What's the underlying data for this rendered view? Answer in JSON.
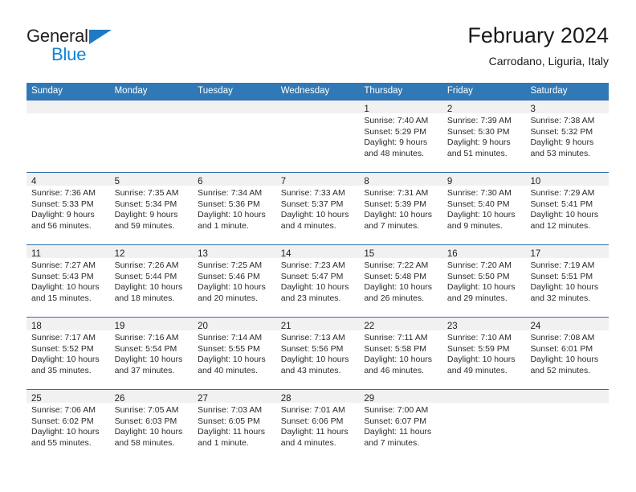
{
  "brand": {
    "name_part1": "General",
    "name_part2": "Blue",
    "triangle_icon": "logo-triangle-icon",
    "accent_color": "#0f84d8"
  },
  "header": {
    "month_title": "February 2024",
    "location": "Carrodano, Liguria, Italy"
  },
  "calendar": {
    "header_color": "#3079b6",
    "row_divider_color": "#2f6fa8",
    "day_band_color": "#f1f1f1",
    "weekdays": [
      "Sunday",
      "Monday",
      "Tuesday",
      "Wednesday",
      "Thursday",
      "Friday",
      "Saturday"
    ],
    "weeks": [
      [
        {
          "day": "",
          "sunrise": "",
          "sunset": "",
          "daylight_line1": "",
          "daylight_line2": ""
        },
        {
          "day": "",
          "sunrise": "",
          "sunset": "",
          "daylight_line1": "",
          "daylight_line2": ""
        },
        {
          "day": "",
          "sunrise": "",
          "sunset": "",
          "daylight_line1": "",
          "daylight_line2": ""
        },
        {
          "day": "",
          "sunrise": "",
          "sunset": "",
          "daylight_line1": "",
          "daylight_line2": ""
        },
        {
          "day": "1",
          "sunrise": "Sunrise: 7:40 AM",
          "sunset": "Sunset: 5:29 PM",
          "daylight_line1": "Daylight: 9 hours",
          "daylight_line2": "and 48 minutes."
        },
        {
          "day": "2",
          "sunrise": "Sunrise: 7:39 AM",
          "sunset": "Sunset: 5:30 PM",
          "daylight_line1": "Daylight: 9 hours",
          "daylight_line2": "and 51 minutes."
        },
        {
          "day": "3",
          "sunrise": "Sunrise: 7:38 AM",
          "sunset": "Sunset: 5:32 PM",
          "daylight_line1": "Daylight: 9 hours",
          "daylight_line2": "and 53 minutes."
        }
      ],
      [
        {
          "day": "4",
          "sunrise": "Sunrise: 7:36 AM",
          "sunset": "Sunset: 5:33 PM",
          "daylight_line1": "Daylight: 9 hours",
          "daylight_line2": "and 56 minutes."
        },
        {
          "day": "5",
          "sunrise": "Sunrise: 7:35 AM",
          "sunset": "Sunset: 5:34 PM",
          "daylight_line1": "Daylight: 9 hours",
          "daylight_line2": "and 59 minutes."
        },
        {
          "day": "6",
          "sunrise": "Sunrise: 7:34 AM",
          "sunset": "Sunset: 5:36 PM",
          "daylight_line1": "Daylight: 10 hours",
          "daylight_line2": "and 1 minute."
        },
        {
          "day": "7",
          "sunrise": "Sunrise: 7:33 AM",
          "sunset": "Sunset: 5:37 PM",
          "daylight_line1": "Daylight: 10 hours",
          "daylight_line2": "and 4 minutes."
        },
        {
          "day": "8",
          "sunrise": "Sunrise: 7:31 AM",
          "sunset": "Sunset: 5:39 PM",
          "daylight_line1": "Daylight: 10 hours",
          "daylight_line2": "and 7 minutes."
        },
        {
          "day": "9",
          "sunrise": "Sunrise: 7:30 AM",
          "sunset": "Sunset: 5:40 PM",
          "daylight_line1": "Daylight: 10 hours",
          "daylight_line2": "and 9 minutes."
        },
        {
          "day": "10",
          "sunrise": "Sunrise: 7:29 AM",
          "sunset": "Sunset: 5:41 PM",
          "daylight_line1": "Daylight: 10 hours",
          "daylight_line2": "and 12 minutes."
        }
      ],
      [
        {
          "day": "11",
          "sunrise": "Sunrise: 7:27 AM",
          "sunset": "Sunset: 5:43 PM",
          "daylight_line1": "Daylight: 10 hours",
          "daylight_line2": "and 15 minutes."
        },
        {
          "day": "12",
          "sunrise": "Sunrise: 7:26 AM",
          "sunset": "Sunset: 5:44 PM",
          "daylight_line1": "Daylight: 10 hours",
          "daylight_line2": "and 18 minutes."
        },
        {
          "day": "13",
          "sunrise": "Sunrise: 7:25 AM",
          "sunset": "Sunset: 5:46 PM",
          "daylight_line1": "Daylight: 10 hours",
          "daylight_line2": "and 20 minutes."
        },
        {
          "day": "14",
          "sunrise": "Sunrise: 7:23 AM",
          "sunset": "Sunset: 5:47 PM",
          "daylight_line1": "Daylight: 10 hours",
          "daylight_line2": "and 23 minutes."
        },
        {
          "day": "15",
          "sunrise": "Sunrise: 7:22 AM",
          "sunset": "Sunset: 5:48 PM",
          "daylight_line1": "Daylight: 10 hours",
          "daylight_line2": "and 26 minutes."
        },
        {
          "day": "16",
          "sunrise": "Sunrise: 7:20 AM",
          "sunset": "Sunset: 5:50 PM",
          "daylight_line1": "Daylight: 10 hours",
          "daylight_line2": "and 29 minutes."
        },
        {
          "day": "17",
          "sunrise": "Sunrise: 7:19 AM",
          "sunset": "Sunset: 5:51 PM",
          "daylight_line1": "Daylight: 10 hours",
          "daylight_line2": "and 32 minutes."
        }
      ],
      [
        {
          "day": "18",
          "sunrise": "Sunrise: 7:17 AM",
          "sunset": "Sunset: 5:52 PM",
          "daylight_line1": "Daylight: 10 hours",
          "daylight_line2": "and 35 minutes."
        },
        {
          "day": "19",
          "sunrise": "Sunrise: 7:16 AM",
          "sunset": "Sunset: 5:54 PM",
          "daylight_line1": "Daylight: 10 hours",
          "daylight_line2": "and 37 minutes."
        },
        {
          "day": "20",
          "sunrise": "Sunrise: 7:14 AM",
          "sunset": "Sunset: 5:55 PM",
          "daylight_line1": "Daylight: 10 hours",
          "daylight_line2": "and 40 minutes."
        },
        {
          "day": "21",
          "sunrise": "Sunrise: 7:13 AM",
          "sunset": "Sunset: 5:56 PM",
          "daylight_line1": "Daylight: 10 hours",
          "daylight_line2": "and 43 minutes."
        },
        {
          "day": "22",
          "sunrise": "Sunrise: 7:11 AM",
          "sunset": "Sunset: 5:58 PM",
          "daylight_line1": "Daylight: 10 hours",
          "daylight_line2": "and 46 minutes."
        },
        {
          "day": "23",
          "sunrise": "Sunrise: 7:10 AM",
          "sunset": "Sunset: 5:59 PM",
          "daylight_line1": "Daylight: 10 hours",
          "daylight_line2": "and 49 minutes."
        },
        {
          "day": "24",
          "sunrise": "Sunrise: 7:08 AM",
          "sunset": "Sunset: 6:01 PM",
          "daylight_line1": "Daylight: 10 hours",
          "daylight_line2": "and 52 minutes."
        }
      ],
      [
        {
          "day": "25",
          "sunrise": "Sunrise: 7:06 AM",
          "sunset": "Sunset: 6:02 PM",
          "daylight_line1": "Daylight: 10 hours",
          "daylight_line2": "and 55 minutes."
        },
        {
          "day": "26",
          "sunrise": "Sunrise: 7:05 AM",
          "sunset": "Sunset: 6:03 PM",
          "daylight_line1": "Daylight: 10 hours",
          "daylight_line2": "and 58 minutes."
        },
        {
          "day": "27",
          "sunrise": "Sunrise: 7:03 AM",
          "sunset": "Sunset: 6:05 PM",
          "daylight_line1": "Daylight: 11 hours",
          "daylight_line2": "and 1 minute."
        },
        {
          "day": "28",
          "sunrise": "Sunrise: 7:01 AM",
          "sunset": "Sunset: 6:06 PM",
          "daylight_line1": "Daylight: 11 hours",
          "daylight_line2": "and 4 minutes."
        },
        {
          "day": "29",
          "sunrise": "Sunrise: 7:00 AM",
          "sunset": "Sunset: 6:07 PM",
          "daylight_line1": "Daylight: 11 hours",
          "daylight_line2": "and 7 minutes."
        },
        {
          "day": "",
          "sunrise": "",
          "sunset": "",
          "daylight_line1": "",
          "daylight_line2": ""
        },
        {
          "day": "",
          "sunrise": "",
          "sunset": "",
          "daylight_line1": "",
          "daylight_line2": ""
        }
      ]
    ]
  }
}
